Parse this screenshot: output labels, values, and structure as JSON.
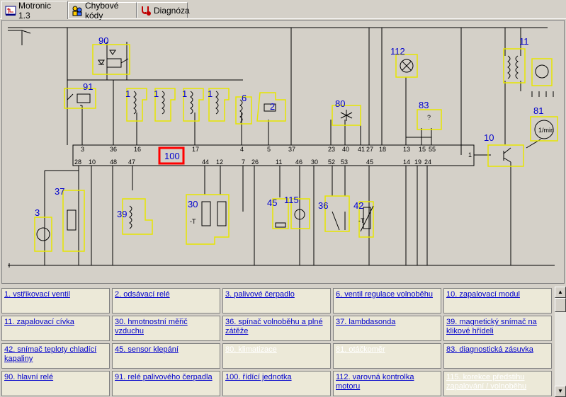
{
  "tabs": [
    {
      "label": "Motronic 1.3",
      "icon": "circuit-icon",
      "active": true
    },
    {
      "label": "Chybové kódy",
      "icon": "people-icon",
      "active": false
    },
    {
      "label": "Diagnóza",
      "icon": "stethoscope-icon",
      "active": false
    }
  ],
  "diagram": {
    "ecu_label": "100",
    "components": [
      "90",
      "91",
      "1",
      "1",
      "1",
      "1",
      "6",
      "2",
      "80",
      "112",
      "83",
      "11",
      "81",
      "10",
      "3",
      "37",
      "39",
      "30",
      "45",
      "115",
      "36",
      "42"
    ],
    "ecu_pins_top": [
      "3",
      "36",
      "16",
      "17",
      "4",
      "5",
      "37",
      "23",
      "40",
      "41",
      "27",
      "18",
      "13",
      "15",
      "55",
      "1"
    ],
    "ecu_pins_bottom": [
      "28",
      "10",
      "48",
      "47",
      "44",
      "12",
      "7",
      "26",
      "11",
      "46",
      "30",
      "52",
      "53",
      "45",
      "14",
      "19",
      "24"
    ],
    "small_labels": {
      "rpm": "1/min",
      "temp": "-T",
      "question": "?"
    },
    "colors": {
      "highlight": "#ffff00",
      "ecu_border": "#ff0000",
      "label": "#0000cc",
      "wire": "#000000"
    }
  },
  "legend": [
    [
      "1. vstřikovací ventil",
      "2. odsávací relé",
      "3. palivové čerpadlo",
      "6. ventil regulace volnoběhu",
      "10. zapalovací modul"
    ],
    [
      "11. zapalovací cívka",
      "30. hmotnostní měřič vzduchu",
      "36. spínač volnoběhu a plné zátěže",
      "37. lambdasonda",
      "39. magnetický snímač na klikové hřídeli"
    ],
    [
      "42. snímač teploty chladící kapaliny",
      "45. sensor klepání",
      "80. klimatizace",
      "81. otáčkoměr",
      "83. diagnostická zásuvka"
    ],
    [
      "90. hlavní relé",
      "91. relé palivového čerpadla",
      "100. řídící jednotka",
      "112. varovná kontrolka motoru",
      "115. korekce předstihu zapalování / volnoběhu"
    ]
  ],
  "legend_dim": [
    [
      false,
      false,
      false,
      false,
      false
    ],
    [
      false,
      false,
      false,
      false,
      false
    ],
    [
      false,
      false,
      true,
      true,
      false
    ],
    [
      false,
      false,
      false,
      false,
      true
    ]
  ]
}
